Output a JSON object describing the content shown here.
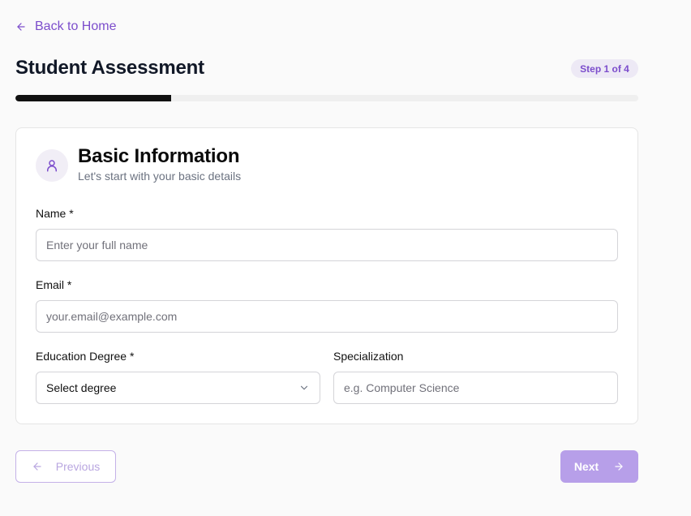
{
  "nav": {
    "back_label": "Back to Home"
  },
  "header": {
    "title": "Student Assessment",
    "step_badge": "Step 1 of 4"
  },
  "progress": {
    "current_step": 1,
    "total_steps": 4,
    "fraction": 0.25
  },
  "section": {
    "icon": "user-icon",
    "title": "Basic Information",
    "subtitle": "Let's start with your basic details"
  },
  "form": {
    "name": {
      "label": "Name *",
      "value": "",
      "placeholder": "Enter your full name"
    },
    "email": {
      "label": "Email *",
      "value": "",
      "placeholder": "your.email@example.com"
    },
    "degree": {
      "label": "Education Degree *",
      "selected": "Select degree"
    },
    "specialization": {
      "label": "Specialization",
      "value": "",
      "placeholder": "e.g. Computer Science"
    }
  },
  "actions": {
    "previous_label": "Previous",
    "next_label": "Next"
  },
  "colors": {
    "accent": "#7c4dcc",
    "next_button": "#b79fe9",
    "progress": "#111111"
  }
}
